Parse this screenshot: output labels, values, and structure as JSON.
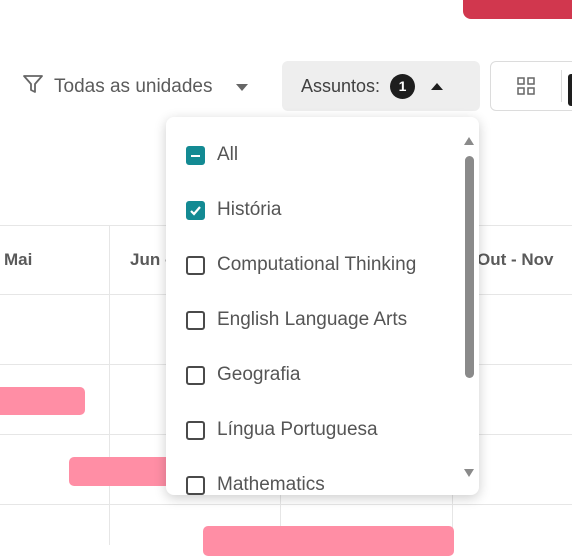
{
  "toolbar": {
    "units_filter_label": "Todas as unidades",
    "subjects_label": "Assuntos:",
    "subjects_count": "1"
  },
  "timeline": {
    "columns": [
      "Mai",
      "Jun -",
      "Out - Nov"
    ],
    "bar_color": "#ff8ea5"
  },
  "dropdown": {
    "options": [
      {
        "label": "All",
        "state": "indeterminate"
      },
      {
        "label": "História",
        "state": "checked"
      },
      {
        "label": "Computational Thinking",
        "state": "unchecked"
      },
      {
        "label": "English Language Arts",
        "state": "unchecked"
      },
      {
        "label": "Geografia",
        "state": "unchecked"
      },
      {
        "label": "Língua Portuguesa",
        "state": "unchecked"
      },
      {
        "label": "Mathematics",
        "state": "unchecked"
      }
    ]
  },
  "colors": {
    "accent": "#138a93",
    "brand_red": "#d1374e"
  }
}
